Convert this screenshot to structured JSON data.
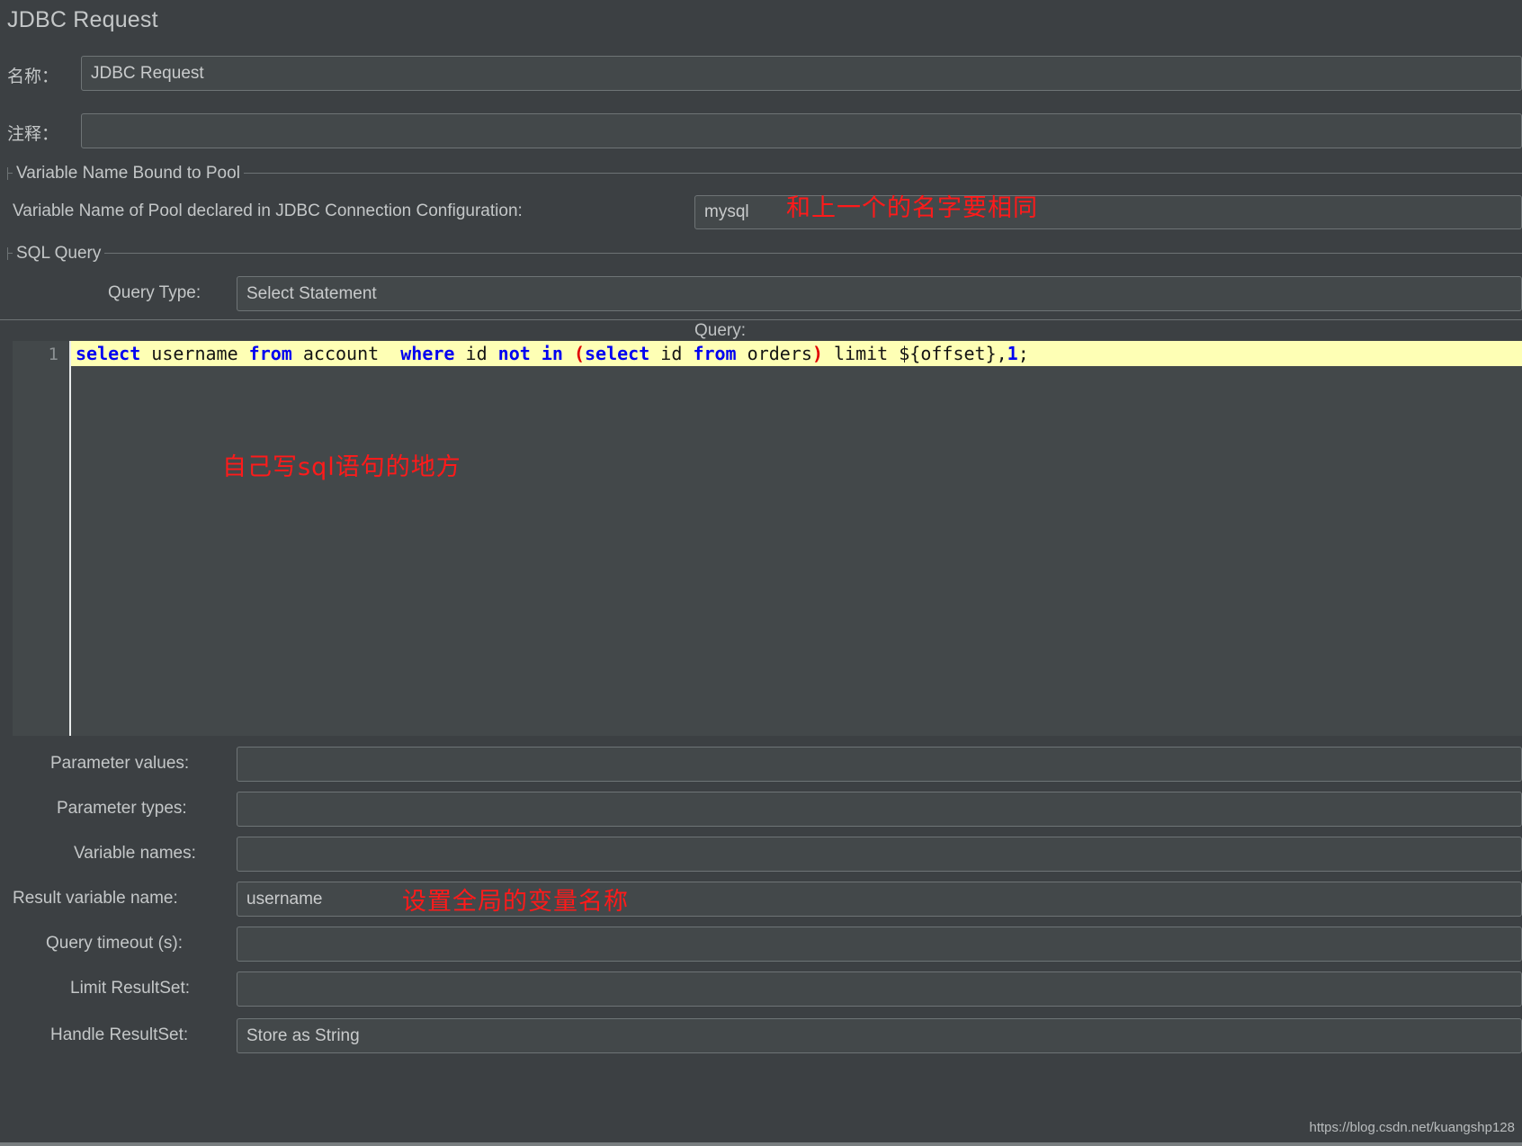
{
  "window": {
    "title": "JDBC Request",
    "watermark": "https://blog.csdn.net/kuangshp128"
  },
  "header_fields": [
    {
      "label": "名称：",
      "value": "JDBC Request",
      "placeholder": ""
    },
    {
      "label": "注释：",
      "value": "",
      "placeholder": ""
    }
  ],
  "pool_group": {
    "title": "Variable Name Bound to Pool",
    "label": "Variable Name of Pool declared in JDBC Connection Configuration:",
    "value": "mysql",
    "annotation": "和上一个的名字要相同"
  },
  "sql_group": {
    "title": "SQL Query",
    "query_type_label": "Query Type:",
    "query_type_value": "Select Statement",
    "query_label": "Query:",
    "line_number": "1",
    "annotation": "自己写sql语句的地方",
    "query_text": "select username from account  where id not in (select id from orders) limit ${offset},1;",
    "query_tokens": [
      {
        "t": "select",
        "k": "kw"
      },
      {
        "t": " username ",
        "k": "txt"
      },
      {
        "t": "from",
        "k": "kw"
      },
      {
        "t": " account  ",
        "k": "txt"
      },
      {
        "t": "where",
        "k": "kw"
      },
      {
        "t": " id ",
        "k": "txt"
      },
      {
        "t": "not",
        "k": "kw"
      },
      {
        "t": " ",
        "k": "txt"
      },
      {
        "t": "in",
        "k": "kw"
      },
      {
        "t": " ",
        "k": "txt"
      },
      {
        "t": "(",
        "k": "punc"
      },
      {
        "t": "select",
        "k": "kw"
      },
      {
        "t": " id ",
        "k": "txt"
      },
      {
        "t": "from",
        "k": "kw"
      },
      {
        "t": " orders",
        "k": "txt"
      },
      {
        "t": ")",
        "k": "punc"
      },
      {
        "t": " limit ${offset},",
        "k": "txt"
      },
      {
        "t": "1",
        "k": "num"
      },
      {
        "t": ";",
        "k": "txt"
      }
    ]
  },
  "result_fields": [
    {
      "label": "Parameter values:",
      "value": ""
    },
    {
      "label": "Parameter types:",
      "value": ""
    },
    {
      "label": "Variable names:",
      "value": ""
    },
    {
      "label": "Result variable name:",
      "value": "username"
    },
    {
      "label": "Query timeout (s):",
      "value": ""
    },
    {
      "label": "Limit ResultSet:",
      "value": ""
    },
    {
      "label": "Handle ResultSet:",
      "value": "Store as String"
    }
  ],
  "result_annotation": "设置全局的变量名称",
  "colors": {
    "background": "#3c4043",
    "field_fill": "#43484a",
    "field_border": "#6e7476",
    "text": "#c4c7c8",
    "annotation_red": "#ff1a1a",
    "editor_line_highlight": "#feffb5",
    "sql_keyword": "#0000f0",
    "sql_punctuation": "#e00000"
  }
}
